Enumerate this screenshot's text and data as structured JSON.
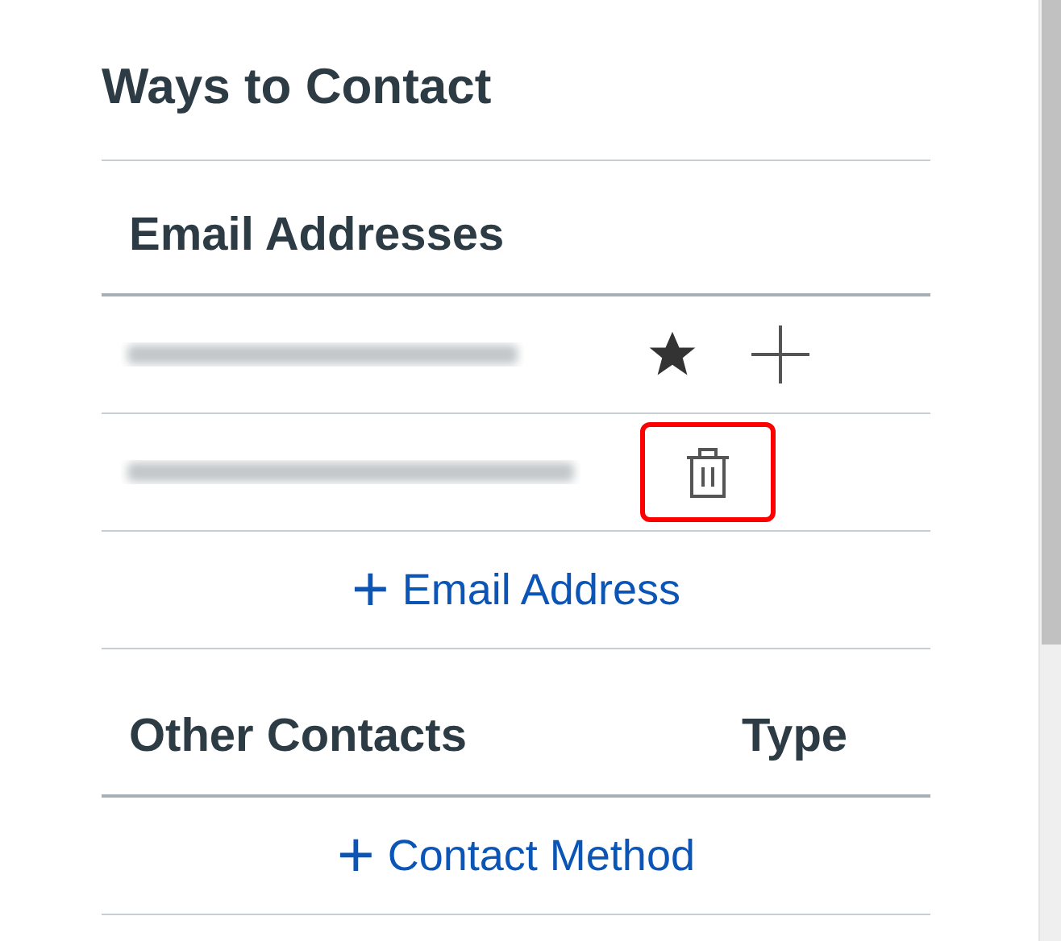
{
  "title": "Ways to Contact",
  "email_section": {
    "heading": "Email Addresses",
    "emails": [
      {
        "default": true,
        "highlighted": false
      },
      {
        "default": false,
        "highlighted": true
      }
    ],
    "add_link": {
      "icon": "+",
      "label": "Email Address"
    }
  },
  "other_section": {
    "columns": [
      "Other Contacts",
      "Type"
    ],
    "add_link": {
      "icon": "+",
      "label": "Contact Method"
    }
  }
}
